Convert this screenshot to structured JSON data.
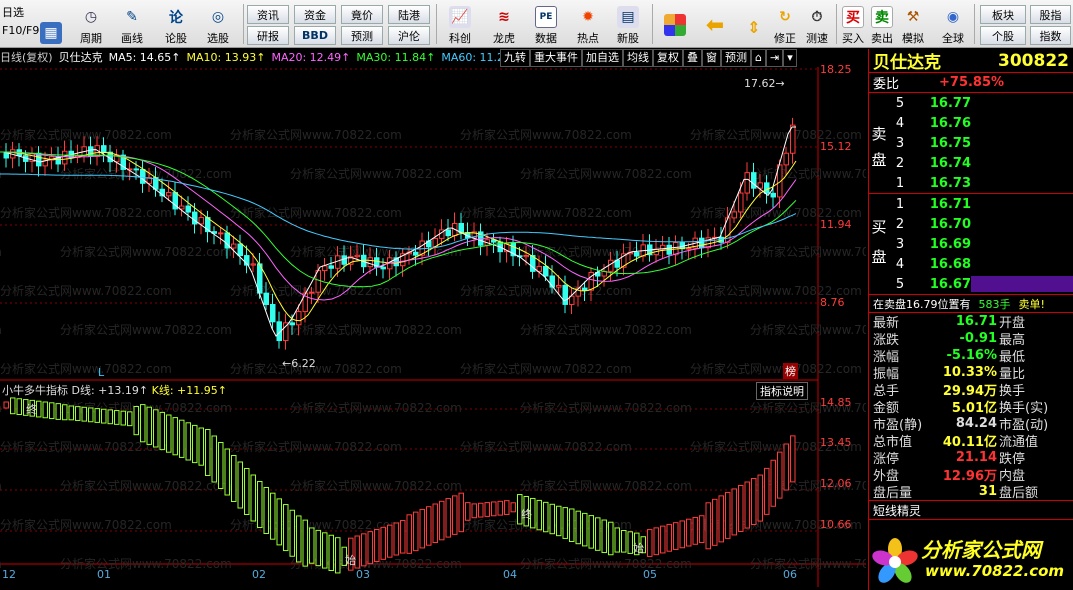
{
  "toolbar": {
    "left_stack": [
      "日选",
      "F10/F9"
    ],
    "large": [
      {
        "label": "周期",
        "icon": "clock-icon"
      },
      {
        "label": "画线",
        "icon": "pencil-icon"
      },
      {
        "label": "论股",
        "icon": "discuss-icon"
      },
      {
        "label": "选股",
        "icon": "select-stock-icon"
      }
    ],
    "small_top": [
      "资讯",
      "资金",
      "竟价",
      "陆港"
    ],
    "small_bottom": [
      "研报",
      "BBD",
      "预测",
      "沪伦"
    ],
    "large2": [
      {
        "label": "科创",
        "icon": "chart-icon"
      },
      {
        "label": "龙虎",
        "icon": "dragon-icon"
      },
      {
        "label": "数据",
        "icon": "pe-data-icon"
      },
      {
        "label": "热点",
        "icon": "hot-icon"
      },
      {
        "label": "新股",
        "icon": "new-stock-icon"
      }
    ],
    "nav": [
      {
        "label": "",
        "icon": "color-grid-icon"
      },
      {
        "label": "",
        "icon": "arrow-left-icon"
      },
      {
        "label": "",
        "icon": "arrow-updown-icon"
      },
      {
        "label": "修正",
        "icon": "restore-icon"
      },
      {
        "label": "测速",
        "icon": "clock-test-icon"
      }
    ],
    "trade": [
      {
        "label": "买入",
        "glyph": "买",
        "color": "#d00"
      },
      {
        "label": "卖出",
        "glyph": "卖",
        "color": "#080"
      },
      {
        "label": "模拟",
        "glyph": "⚒",
        "color": "#a50"
      },
      {
        "label": "全球",
        "glyph": "◉",
        "color": "#36c"
      }
    ],
    "right_small_top": [
      "板块",
      "股指"
    ],
    "right_small_bottom": [
      "个股",
      "指数"
    ]
  },
  "infobar": {
    "period": "日线(复权)",
    "name": "贝仕达克",
    "ma5": "MA5: 14.65↑",
    "ma10": "MA10: 13.93↑",
    "ma20": "MA20: 12.49↑",
    "ma30": "MA30: 11.84↑",
    "ma60": "MA60: 11.2"
  },
  "chart_buttons": [
    "九转",
    "重大事件",
    "加自选",
    "均线",
    "复权",
    "叠",
    "窗",
    "预测"
  ],
  "price_axis": [
    "18.25",
    "15.12",
    "11.94",
    "8.76"
  ],
  "indicator_axis": [
    "14.85",
    "13.45",
    "12.06",
    "10.66"
  ],
  "date_axis": [
    "12",
    "01",
    "02",
    "03",
    "04",
    "05",
    "06"
  ],
  "annotations": {
    "high": "17.62",
    "low": "6.22",
    "marker_l": "L",
    "bang": "榜"
  },
  "indicator": {
    "title": "小牛多牛指标",
    "d_line": "D线: +13.19↑",
    "k_line": "K线: +11.95↑",
    "help": "指标说明",
    "tags": [
      "终",
      "终",
      "始",
      "始"
    ]
  },
  "watermark": "分析家公式网www.70822.com",
  "stock": {
    "name": "贝仕达克",
    "code": "300822"
  },
  "orderbook": {
    "weibi_label": "委比",
    "weibi_value": "+75.85%",
    "sell_label": [
      "卖",
      "盘"
    ],
    "buy_label": [
      "买",
      "盘"
    ],
    "asks": [
      {
        "level": "5",
        "price": "16.77"
      },
      {
        "level": "4",
        "price": "16.76"
      },
      {
        "level": "3",
        "price": "16.75"
      },
      {
        "level": "2",
        "price": "16.74"
      },
      {
        "level": "1",
        "price": "16.73"
      }
    ],
    "bids": [
      {
        "level": "1",
        "price": "16.71"
      },
      {
        "level": "2",
        "price": "16.70"
      },
      {
        "level": "3",
        "price": "16.69"
      },
      {
        "level": "4",
        "price": "16.68"
      },
      {
        "level": "5",
        "price": "16.67"
      }
    ]
  },
  "notice": {
    "text": "在卖盘16.79位置有",
    "qty": "583手",
    "action": "卖单!"
  },
  "stats": [
    {
      "l1": "最新",
      "v": "16.71",
      "c": "#2f2",
      "l2": "开盘"
    },
    {
      "l1": "涨跌",
      "v": "-0.91",
      "c": "#2f2",
      "l2": "最高"
    },
    {
      "l1": "涨幅",
      "v": "-5.16%",
      "c": "#2f2",
      "l2": "最低"
    },
    {
      "l1": "振幅",
      "v": "10.33%",
      "c": "#ff3",
      "l2": "量比"
    },
    {
      "l1": "总手",
      "v": "29.94万",
      "c": "#ff3",
      "l2": "换手"
    },
    {
      "l1": "金额",
      "v": "5.01亿",
      "c": "#ff3",
      "l2": "换手(实)"
    },
    {
      "l1": "市盈(静)",
      "v": "84.24",
      "c": "#ddd",
      "l2": "市盈(动)"
    },
    {
      "l1": "总市值",
      "v": "40.11亿",
      "c": "#ff3",
      "l2": "流通值"
    },
    {
      "l1": "涨停",
      "v": "21.14",
      "c": "#f33",
      "l2": "跌停"
    },
    {
      "l1": "外盘",
      "v": "12.96万",
      "c": "#f33",
      "l2": "内盘"
    },
    {
      "l1": "盘后量",
      "v": "31",
      "c": "#ff3",
      "l2": "盘后额"
    }
  ],
  "elf": "短线精灵",
  "logo": {
    "title": "分析家公式网",
    "url": "www.70822.com"
  }
}
